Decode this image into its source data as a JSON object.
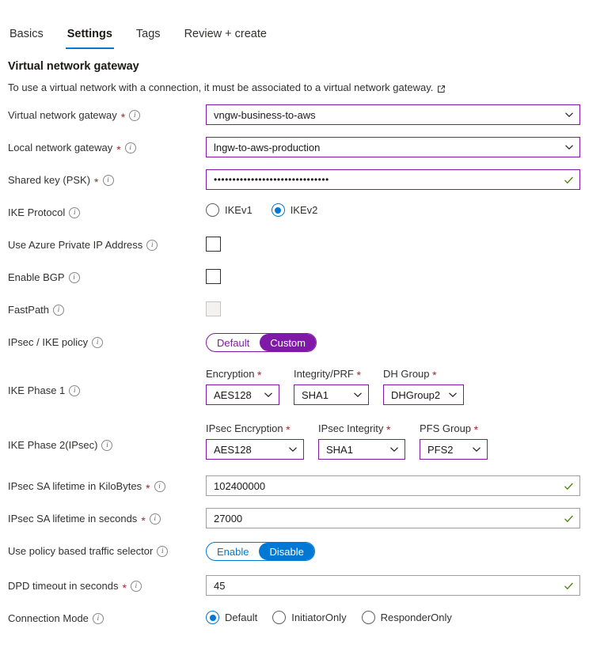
{
  "tabs": [
    {
      "label": "Basics",
      "active": false
    },
    {
      "label": "Settings",
      "active": true
    },
    {
      "label": "Tags",
      "active": false
    },
    {
      "label": "Review + create",
      "active": false
    }
  ],
  "section": {
    "title": "Virtual network gateway",
    "description": "To use a virtual network with a connection, it must be associated to a virtual network gateway.",
    "link_icon": "external-link-icon"
  },
  "colors": {
    "accent_blue": "#0078d4",
    "accent_purple": "#8019a8",
    "required_red": "#a4262c",
    "valid_green": "#498205"
  },
  "fields": {
    "vnet_gateway": {
      "label": "Virtual network gateway",
      "required": "*",
      "value": "vngw-business-to-aws"
    },
    "local_gateway": {
      "label": "Local network gateway",
      "required": "*",
      "value": "lngw-to-aws-production"
    },
    "shared_key": {
      "label": "Shared key (PSK)",
      "required": "*",
      "value": "•••••••••••••••••••••••••••••••"
    },
    "ike_protocol": {
      "label": "IKE Protocol",
      "options": [
        {
          "label": "IKEv1",
          "selected": false
        },
        {
          "label": "IKEv2",
          "selected": true
        }
      ]
    },
    "private_ip": {
      "label": "Use Azure Private IP Address",
      "checked": false,
      "disabled": false
    },
    "enable_bgp": {
      "label": "Enable BGP",
      "checked": false,
      "disabled": false
    },
    "fastpath": {
      "label": "FastPath",
      "checked": false,
      "disabled": true
    },
    "ipsec_ike_policy": {
      "label": "IPsec / IKE policy",
      "options": [
        {
          "label": "Default",
          "selected": false
        },
        {
          "label": "Custom",
          "selected": true
        }
      ]
    },
    "ike_phase_1": {
      "label": "IKE Phase 1",
      "subfields": [
        {
          "label": "Encryption",
          "required": "*",
          "value": "AES128"
        },
        {
          "label": "Integrity/PRF",
          "required": "*",
          "value": "SHA1"
        },
        {
          "label": "DH Group",
          "required": "*",
          "value": "DHGroup2"
        }
      ]
    },
    "ike_phase_2": {
      "label": "IKE Phase 2(IPsec)",
      "subfields": [
        {
          "label": "IPsec Encryption",
          "required": "*",
          "value": "AES128"
        },
        {
          "label": "IPsec Integrity",
          "required": "*",
          "value": "SHA1"
        },
        {
          "label": "PFS Group",
          "required": "*",
          "value": "PFS2"
        }
      ]
    },
    "sa_lifetime_kb": {
      "label": "IPsec SA lifetime in KiloBytes",
      "required": "*",
      "value": "102400000"
    },
    "sa_lifetime_sec": {
      "label": "IPsec SA lifetime in seconds",
      "required": "*",
      "value": "27000"
    },
    "traffic_selector": {
      "label": "Use policy based traffic selector",
      "options": [
        {
          "label": "Enable",
          "selected": false
        },
        {
          "label": "Disable",
          "selected": true
        }
      ]
    },
    "dpd_timeout": {
      "label": "DPD timeout in seconds",
      "required": "*",
      "value": "45"
    },
    "connection_mode": {
      "label": "Connection Mode",
      "options": [
        {
          "label": "Default",
          "selected": true
        },
        {
          "label": "InitiatorOnly",
          "selected": false
        },
        {
          "label": "ResponderOnly",
          "selected": false
        }
      ]
    }
  }
}
